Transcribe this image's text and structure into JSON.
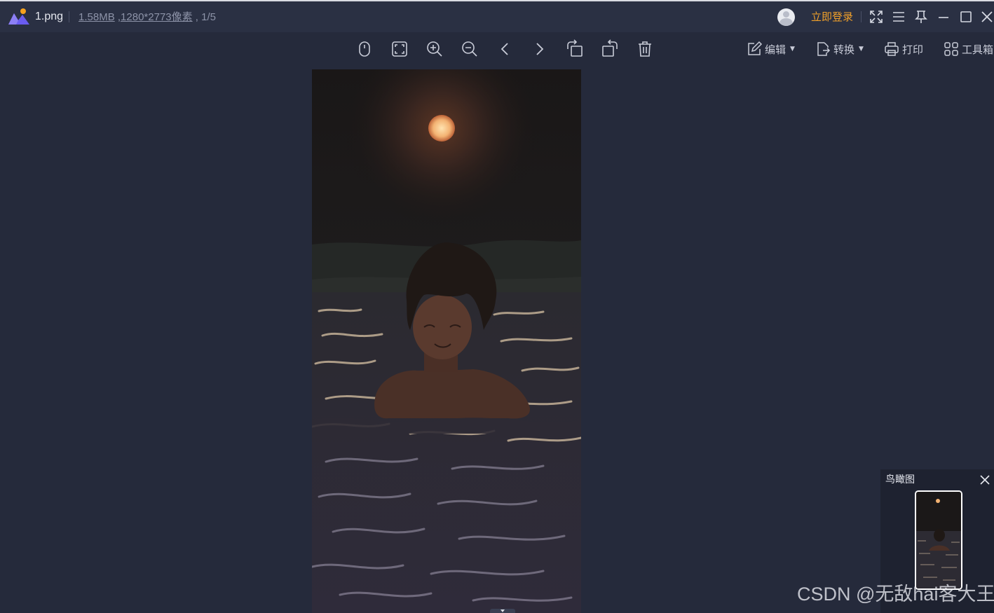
{
  "titlebar": {
    "file_name": "1.png",
    "file_size": "1.58MB",
    "dimensions": "1280*2773像素",
    "position": "1/5",
    "login_label": "立即登录",
    "controls": [
      "fullscreen-icon",
      "menu-icon",
      "pin-icon",
      "minimize-icon",
      "maximize-icon",
      "close-icon"
    ]
  },
  "toolbar": {
    "icons": [
      "mouse-icon",
      "fit-window-icon",
      "zoom-in-icon",
      "zoom-out-icon",
      "previous-icon",
      "next-icon",
      "rotate-left-icon",
      "rotate-right-icon",
      "delete-icon"
    ],
    "edit_label": "编辑",
    "convert_label": "转换",
    "print_label": "打印",
    "tools_label": "工具箱"
  },
  "navigator": {
    "title": "鸟瞰图"
  },
  "watermark": "CSDN @无敌hai客大王",
  "colors": {
    "background": "#252a3b",
    "titlebar": "#2a3043",
    "accent_login": "#f0a02a",
    "logo_purple": "#6a5cf0",
    "logo_orange": "#f6a21e"
  }
}
